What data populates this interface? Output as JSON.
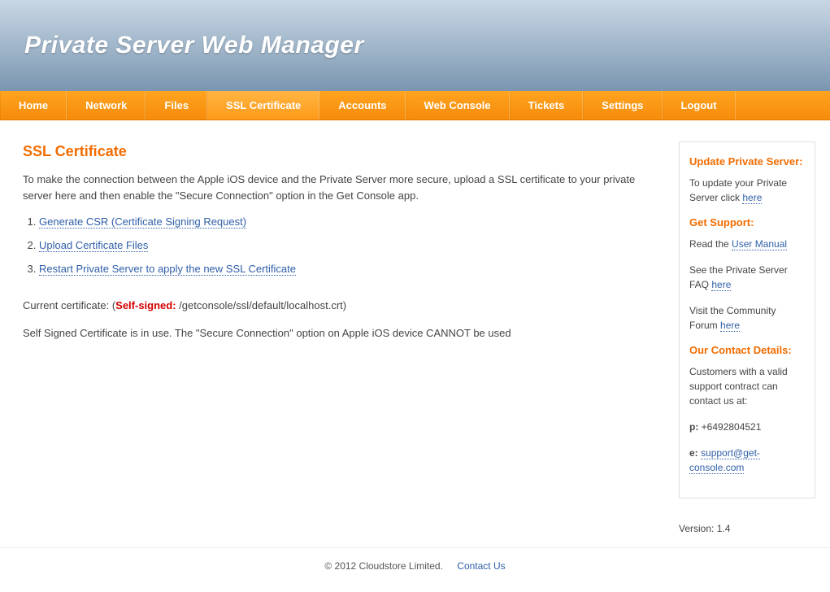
{
  "header": {
    "title": "Private Server Web Manager"
  },
  "nav": {
    "items": [
      "Home",
      "Network",
      "Files",
      "SSL Certificate",
      "Accounts",
      "Web Console",
      "Tickets",
      "Settings",
      "Logout"
    ],
    "active_index": 3
  },
  "main": {
    "title": "SSL Certificate",
    "intro": "To make the connection between the Apple iOS device and the Private Server more secure, upload a SSL certificate to your private server here and then enable the \"Secure Connection\" option in the Get Console app.",
    "steps": [
      "Generate CSR (Certificate Signing Request)",
      "Upload Certificate Files",
      "Restart Private Server to apply the new SSL Certificate"
    ],
    "current_cert_prefix": "Current certificate: (",
    "current_cert_status": "Self-signed:",
    "current_cert_path": " /getconsole/ssl/default/localhost.crt)",
    "note": "Self Signed Certificate is in use. The \"Secure Connection\" option on Apple iOS device CANNOT be used"
  },
  "sidebar": {
    "section1": {
      "title": "Update Private Server:",
      "text_before": "To update your Private Server click ",
      "link": "here"
    },
    "section2": {
      "title": "Get Support:",
      "line1_before": "Read the ",
      "line1_link": "User Manual",
      "line2_before": "See the Private Server FAQ ",
      "line2_link": "here",
      "line3_before": "Visit the Community Forum ",
      "line3_link": "here"
    },
    "section3": {
      "title": "Our Contact Details:",
      "text": "Customers with a valid support contract can contact us at:",
      "phone_label": "p:",
      "phone": " +6492804521",
      "email_label": "e:",
      "email": "support@get-console.com"
    }
  },
  "version_label": "Version: 1.4",
  "footer": {
    "copyright": "© 2012 Cloudstore Limited.",
    "contact": "Contact Us"
  }
}
